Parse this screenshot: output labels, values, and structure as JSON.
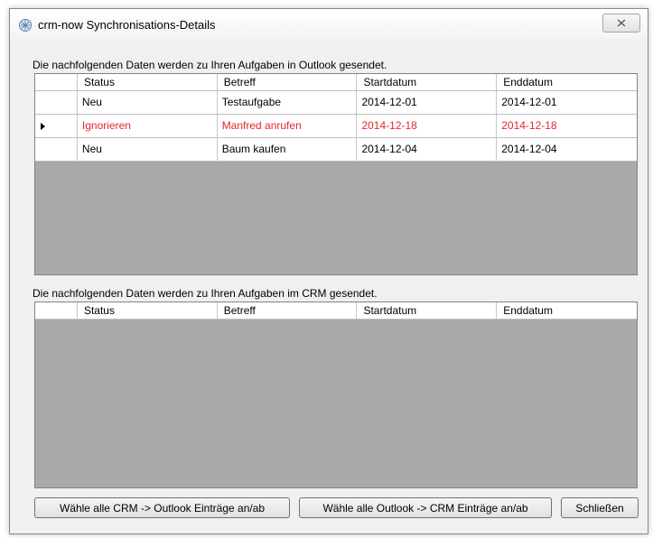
{
  "window": {
    "title": "crm-now Synchronisations-Details"
  },
  "outlook_section": {
    "label": "Die nachfolgenden Daten werden zu Ihren Aufgaben in Outlook gesendet.",
    "columns": [
      "Status",
      "Betreff",
      "Startdatum",
      "Enddatum"
    ],
    "rows": [
      {
        "status": "Neu",
        "betreff": "Testaufgabe",
        "start": "2014-12-01",
        "end": "2014-12-01"
      },
      {
        "status": "Ignorieren",
        "betreff": "Manfred anrufen",
        "start": "2014-12-18",
        "end": "2014-12-18"
      },
      {
        "status": "Neu",
        "betreff": "Baum kaufen",
        "start": "2014-12-04",
        "end": "2014-12-04"
      }
    ]
  },
  "crm_section": {
    "label": "Die nachfolgenden Daten werden zu Ihren Aufgaben im CRM gesendet.",
    "columns": [
      "Status",
      "Betreff",
      "Startdatum",
      "Enddatum"
    ],
    "rows": []
  },
  "buttons": {
    "crm_to_outlook": "Wähle alle CRM -> Outlook Einträge an/ab",
    "outlook_to_crm": "Wähle alle Outlook -> CRM Einträge an/ab",
    "close": "Schließen"
  },
  "colors": {
    "ignored_row_text": "#e8262b",
    "grid_background": "#a9a9a9"
  },
  "icons": {
    "app": "crm-now-logo-icon",
    "close": "close-icon",
    "row_selector": "row-pointer-icon"
  }
}
